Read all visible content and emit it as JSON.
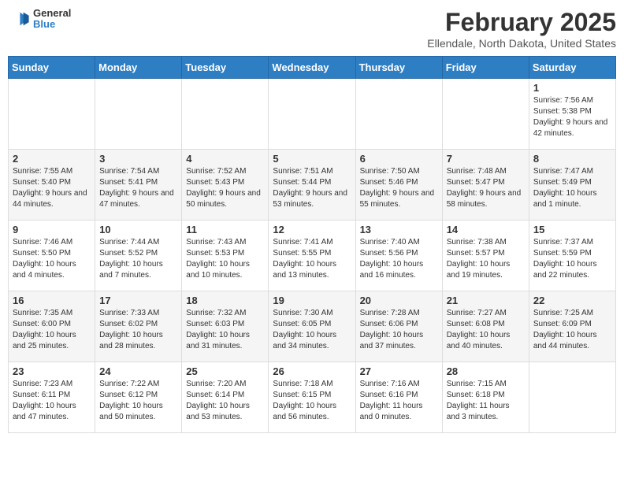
{
  "header": {
    "logo_line1": "General",
    "logo_line2": "Blue",
    "month_year": "February 2025",
    "location": "Ellendale, North Dakota, United States"
  },
  "days_of_week": [
    "Sunday",
    "Monday",
    "Tuesday",
    "Wednesday",
    "Thursday",
    "Friday",
    "Saturday"
  ],
  "weeks": [
    [
      {
        "day": "",
        "info": ""
      },
      {
        "day": "",
        "info": ""
      },
      {
        "day": "",
        "info": ""
      },
      {
        "day": "",
        "info": ""
      },
      {
        "day": "",
        "info": ""
      },
      {
        "day": "",
        "info": ""
      },
      {
        "day": "1",
        "info": "Sunrise: 7:56 AM\nSunset: 5:38 PM\nDaylight: 9 hours and 42 minutes."
      }
    ],
    [
      {
        "day": "2",
        "info": "Sunrise: 7:55 AM\nSunset: 5:40 PM\nDaylight: 9 hours and 44 minutes."
      },
      {
        "day": "3",
        "info": "Sunrise: 7:54 AM\nSunset: 5:41 PM\nDaylight: 9 hours and 47 minutes."
      },
      {
        "day": "4",
        "info": "Sunrise: 7:52 AM\nSunset: 5:43 PM\nDaylight: 9 hours and 50 minutes."
      },
      {
        "day": "5",
        "info": "Sunrise: 7:51 AM\nSunset: 5:44 PM\nDaylight: 9 hours and 53 minutes."
      },
      {
        "day": "6",
        "info": "Sunrise: 7:50 AM\nSunset: 5:46 PM\nDaylight: 9 hours and 55 minutes."
      },
      {
        "day": "7",
        "info": "Sunrise: 7:48 AM\nSunset: 5:47 PM\nDaylight: 9 hours and 58 minutes."
      },
      {
        "day": "8",
        "info": "Sunrise: 7:47 AM\nSunset: 5:49 PM\nDaylight: 10 hours and 1 minute."
      }
    ],
    [
      {
        "day": "9",
        "info": "Sunrise: 7:46 AM\nSunset: 5:50 PM\nDaylight: 10 hours and 4 minutes."
      },
      {
        "day": "10",
        "info": "Sunrise: 7:44 AM\nSunset: 5:52 PM\nDaylight: 10 hours and 7 minutes."
      },
      {
        "day": "11",
        "info": "Sunrise: 7:43 AM\nSunset: 5:53 PM\nDaylight: 10 hours and 10 minutes."
      },
      {
        "day": "12",
        "info": "Sunrise: 7:41 AM\nSunset: 5:55 PM\nDaylight: 10 hours and 13 minutes."
      },
      {
        "day": "13",
        "info": "Sunrise: 7:40 AM\nSunset: 5:56 PM\nDaylight: 10 hours and 16 minutes."
      },
      {
        "day": "14",
        "info": "Sunrise: 7:38 AM\nSunset: 5:57 PM\nDaylight: 10 hours and 19 minutes."
      },
      {
        "day": "15",
        "info": "Sunrise: 7:37 AM\nSunset: 5:59 PM\nDaylight: 10 hours and 22 minutes."
      }
    ],
    [
      {
        "day": "16",
        "info": "Sunrise: 7:35 AM\nSunset: 6:00 PM\nDaylight: 10 hours and 25 minutes."
      },
      {
        "day": "17",
        "info": "Sunrise: 7:33 AM\nSunset: 6:02 PM\nDaylight: 10 hours and 28 minutes."
      },
      {
        "day": "18",
        "info": "Sunrise: 7:32 AM\nSunset: 6:03 PM\nDaylight: 10 hours and 31 minutes."
      },
      {
        "day": "19",
        "info": "Sunrise: 7:30 AM\nSunset: 6:05 PM\nDaylight: 10 hours and 34 minutes."
      },
      {
        "day": "20",
        "info": "Sunrise: 7:28 AM\nSunset: 6:06 PM\nDaylight: 10 hours and 37 minutes."
      },
      {
        "day": "21",
        "info": "Sunrise: 7:27 AM\nSunset: 6:08 PM\nDaylight: 10 hours and 40 minutes."
      },
      {
        "day": "22",
        "info": "Sunrise: 7:25 AM\nSunset: 6:09 PM\nDaylight: 10 hours and 44 minutes."
      }
    ],
    [
      {
        "day": "23",
        "info": "Sunrise: 7:23 AM\nSunset: 6:11 PM\nDaylight: 10 hours and 47 minutes."
      },
      {
        "day": "24",
        "info": "Sunrise: 7:22 AM\nSunset: 6:12 PM\nDaylight: 10 hours and 50 minutes."
      },
      {
        "day": "25",
        "info": "Sunrise: 7:20 AM\nSunset: 6:14 PM\nDaylight: 10 hours and 53 minutes."
      },
      {
        "day": "26",
        "info": "Sunrise: 7:18 AM\nSunset: 6:15 PM\nDaylight: 10 hours and 56 minutes."
      },
      {
        "day": "27",
        "info": "Sunrise: 7:16 AM\nSunset: 6:16 PM\nDaylight: 11 hours and 0 minutes."
      },
      {
        "day": "28",
        "info": "Sunrise: 7:15 AM\nSunset: 6:18 PM\nDaylight: 11 hours and 3 minutes."
      },
      {
        "day": "",
        "info": ""
      }
    ]
  ]
}
